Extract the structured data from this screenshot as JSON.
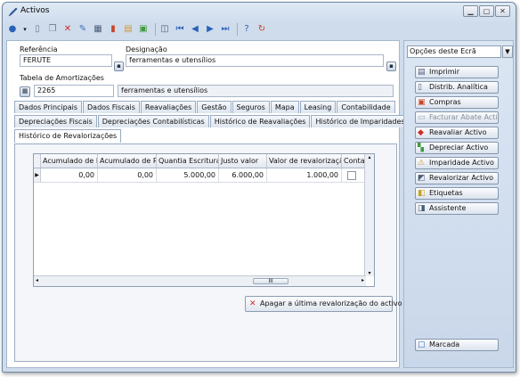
{
  "window": {
    "title": "Activos",
    "icon": "pen-icon",
    "controls": [
      "minimize",
      "maximize",
      "close"
    ]
  },
  "toolbar": {
    "icons": [
      "navigate-icon",
      "dropdown-icon",
      "new-doc-icon",
      "copy-doc-icon",
      "delete-icon",
      "edit-icon",
      "list-icon",
      "chart-icon",
      "report-icon",
      "excel-icon",
      "preview-icon",
      "first-record-icon",
      "previous-record-icon",
      "next-record-icon",
      "last-record-icon",
      "help-icon",
      "refresh-icon"
    ]
  },
  "form": {
    "referencia_label": "Referência",
    "referencia_value": "FERUTE",
    "designacao_label": "Designação",
    "designacao_value": "ferramentas e utensílios",
    "tabela_label": "Tabela de Amortizações",
    "tabela_code": "2265",
    "tabela_desc": "ferramentas e utensílios"
  },
  "tabs_row1": [
    "Dados Principais",
    "Dados Fiscais",
    "Reavaliações",
    "Gestão",
    "Seguros",
    "Mapa",
    "Leasing",
    "Contabilidade"
  ],
  "tabs_row2": [
    "Depreciações Fiscais",
    "Depreciações Contabilísticas",
    "Histórico de Reavaliações",
    "Histórico de Imparidades"
  ],
  "tabs_row3": [
    "Histórico de Revalorizações"
  ],
  "grid": {
    "columns": [
      "Acumulado de Imp",
      "Acumulado de Rev",
      "Quantia Escriturada",
      "Justo valor",
      "Valor de revalorização",
      "Contabil"
    ],
    "rows": [
      [
        "0,00",
        "0,00",
        "5.000,00",
        "6.000,00",
        "1.000,00",
        ""
      ]
    ],
    "scroll_thumb": "III"
  },
  "actions": {
    "apply_last": "Apagar a última revalorização do activo"
  },
  "side": {
    "options_label": "Opções deste Ecrã",
    "buttons": [
      {
        "label": "Imprimir",
        "icon": "printer-icon",
        "enabled": true
      },
      {
        "label": "Distrib. Analítica",
        "icon": "document-icon",
        "enabled": true
      },
      {
        "label": "Compras",
        "icon": "purchases-icon",
        "enabled": true
      },
      {
        "label": "Facturar Abate Activo",
        "icon": "invoice-icon",
        "enabled": false
      },
      {
        "label": "Reavaliar Activo",
        "icon": "diamond-icon",
        "enabled": true
      },
      {
        "label": "Depreciar Activo",
        "icon": "depreciate-icon",
        "enabled": true
      },
      {
        "label": "Imparidade Activo",
        "icon": "warning-icon",
        "enabled": true
      },
      {
        "label": "Revalorizar Activo",
        "icon": "revalue-icon",
        "enabled": true
      },
      {
        "label": "Etiquetas",
        "icon": "labels-icon",
        "enabled": true
      },
      {
        "label": "Assistente",
        "icon": "wizard-icon",
        "enabled": true
      }
    ],
    "marked": "Marcada"
  },
  "colors": {
    "accent": "#2b62b8",
    "delete_red": "#d22b2b",
    "window_bg": "#cfdcec"
  }
}
